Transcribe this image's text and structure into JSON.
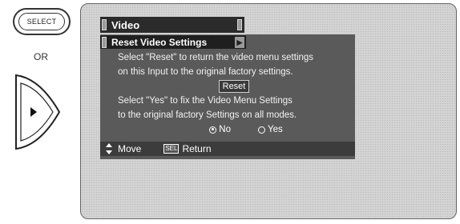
{
  "remote": {
    "select_label": "SELECT",
    "or_label": "OR"
  },
  "menu": {
    "title": "Video",
    "subtitle": "Reset Video Settings",
    "line1": "Select \"Reset\" to return the video menu settings",
    "line2": "on this Input to the original factory settings.",
    "reset_label": "Reset",
    "line3": "Select \"Yes\" to fix the Video Menu Settings",
    "line4": "to the original factory Settings on all modes.",
    "options": [
      {
        "label": "No",
        "selected": true
      },
      {
        "label": "Yes",
        "selected": false
      }
    ]
  },
  "footer": {
    "move_label": "Move",
    "sel_icon_label": "SEL",
    "return_label": "Return"
  },
  "colors": {
    "title_bar": "#2b2b2b",
    "panel": "#5a5a5a",
    "screen": "#d3d3d3"
  }
}
